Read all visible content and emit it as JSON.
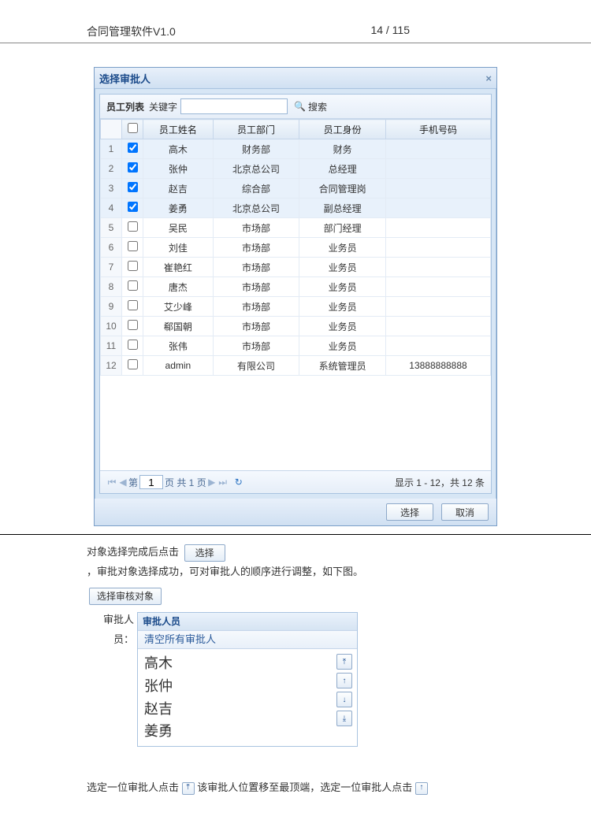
{
  "doc": {
    "title": "合同管理软件V1.0",
    "pagenum": "14 / 115"
  },
  "dialog": {
    "title": "选择审批人",
    "close": "×",
    "select": "选择",
    "cancel": "取消",
    "toolbar": {
      "list_label": "员工列表",
      "keyword_label": "关键字",
      "search": "搜索",
      "placeholder": ""
    },
    "columns": {
      "c1": "员工姓名",
      "c2": "员工部门",
      "c3": "员工身份",
      "c4": "手机号码"
    },
    "rows": [
      {
        "n": "1",
        "ck": true,
        "name": "高木",
        "dept": "财务部",
        "role": "财务",
        "phone": ""
      },
      {
        "n": "2",
        "ck": true,
        "name": "张仲",
        "dept": "北京总公司",
        "role": "总经理",
        "phone": ""
      },
      {
        "n": "3",
        "ck": true,
        "name": "赵吉",
        "dept": "综合部",
        "role": "合同管理岗",
        "phone": ""
      },
      {
        "n": "4",
        "ck": true,
        "name": "姜勇",
        "dept": "北京总公司",
        "role": "副总经理",
        "phone": ""
      },
      {
        "n": "5",
        "ck": false,
        "name": "吴民",
        "dept": "市场部",
        "role": "部门经理",
        "phone": ""
      },
      {
        "n": "6",
        "ck": false,
        "name": "刘佳",
        "dept": "市场部",
        "role": "业务员",
        "phone": ""
      },
      {
        "n": "7",
        "ck": false,
        "name": "崔艳红",
        "dept": "市场部",
        "role": "业务员",
        "phone": ""
      },
      {
        "n": "8",
        "ck": false,
        "name": "唐杰",
        "dept": "市场部",
        "role": "业务员",
        "phone": ""
      },
      {
        "n": "9",
        "ck": false,
        "name": "艾少峰",
        "dept": "市场部",
        "role": "业务员",
        "phone": ""
      },
      {
        "n": "10",
        "ck": false,
        "name": "郗国朝",
        "dept": "市场部",
        "role": "业务员",
        "phone": ""
      },
      {
        "n": "11",
        "ck": false,
        "name": "张伟",
        "dept": "市场部",
        "role": "业务员",
        "phone": ""
      },
      {
        "n": "12",
        "ck": false,
        "name": "admin",
        "dept": "有限公司",
        "role": "系统管理员",
        "phone": "13888888888"
      }
    ],
    "pager": {
      "pre": "第",
      "page": "1",
      "mid": "页  共 1 页",
      "info": "显示 1 - 12，共 12 条"
    }
  },
  "txt": {
    "l1a": "对象选择完成后点击",
    "l1btn": "选择",
    "l2": "，审批对象选择成功，可对审批人的顺序进行调整，如下图。",
    "l3btn": "选择审核对象",
    "l3lbl": "审批人员：",
    "panel_title": "审批人员",
    "clear": "清空所有审批人",
    "names": [
      "高木",
      "张仲",
      "赵吉",
      "姜勇"
    ],
    "l4a": "选定一位审批人点击",
    "l4b": "该审批人位置移至最顶端，选定一位审批人点击"
  }
}
